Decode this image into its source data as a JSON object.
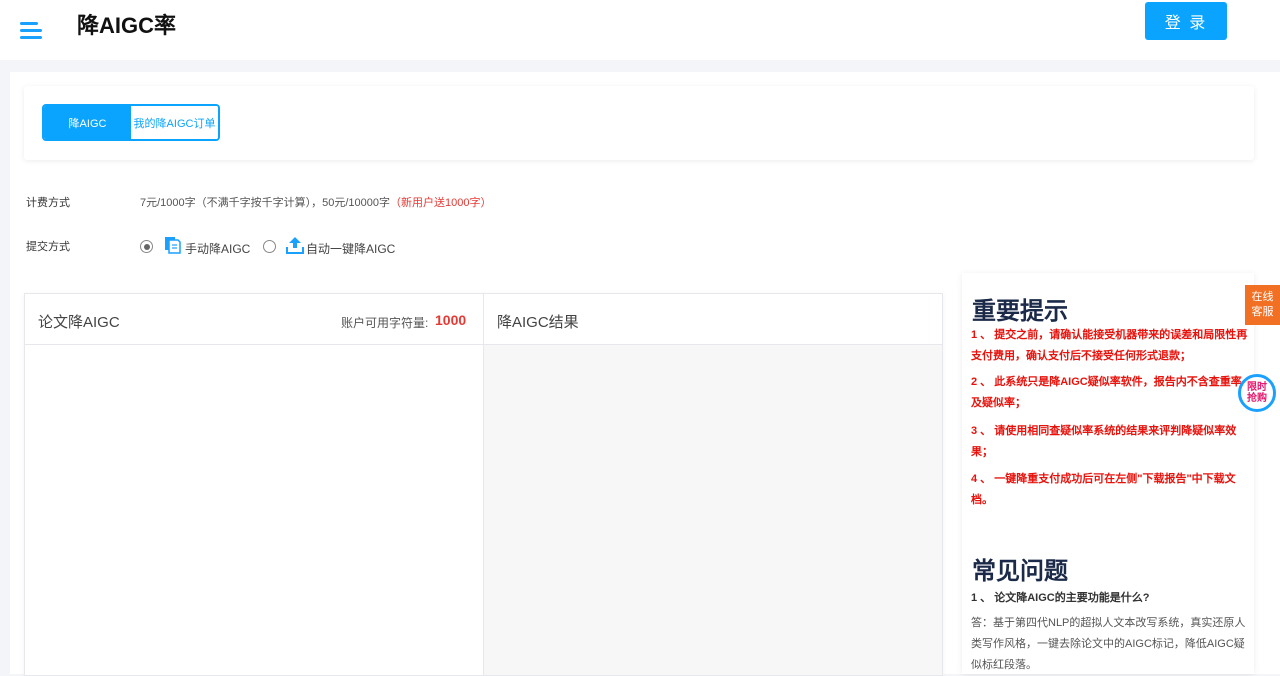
{
  "header": {
    "title": "降AIGC率",
    "login_label": "登 录"
  },
  "tabs": [
    {
      "label": "降AIGC"
    },
    {
      "label": "我的降AIGC订单"
    }
  ],
  "pricing": {
    "label": "计费方式",
    "text": "7元/1000字（不满千字按千字计算），50元/10000字",
    "promo": "（新用户送1000字）"
  },
  "submit": {
    "label": "提交方式",
    "options": [
      {
        "label": "手动降AIGC",
        "selected": true
      },
      {
        "label": "自动一键降AIGC",
        "selected": false
      }
    ]
  },
  "editor": {
    "left_title": "论文降AIGC",
    "quota_label": "账户可用字符量:",
    "quota_value": "1000",
    "right_title": "降AIGC结果"
  },
  "notice": {
    "title": "重要提示",
    "tips": [
      "1 、  提交之前，请确认能接受机器带来的误差和局限性再支付费用，确认支付后不接受任何形式退款；",
      "2 、  此系统只是降AIGC疑似率软件，报告内不含查重率及疑似率；",
      "3 、  请使用相同查疑似率系统的结果来评判降疑似率效果；",
      "4 、  一键降重支付成功后可在左侧\"下载报告\"中下载文档。"
    ],
    "faq_title": "常见问题",
    "faq_q": "1 、  论文降AIGC的主要功能是什么?",
    "faq_a": "答：基于第四代NLP的超拟人文本改写系统，真实还原人类写作风格，一键去除论文中的AIGC标记，降低AIGC疑似标红段落。"
  },
  "float": {
    "service": "在线客服",
    "promo": "限时抢购"
  },
  "colors": {
    "accent": "#0aa4ff",
    "warning": "#e8120c",
    "service": "#f27024"
  },
  "icons": {
    "menu": "hamburger-menu-icon",
    "manual": "document-icon",
    "auto": "upload-icon"
  }
}
